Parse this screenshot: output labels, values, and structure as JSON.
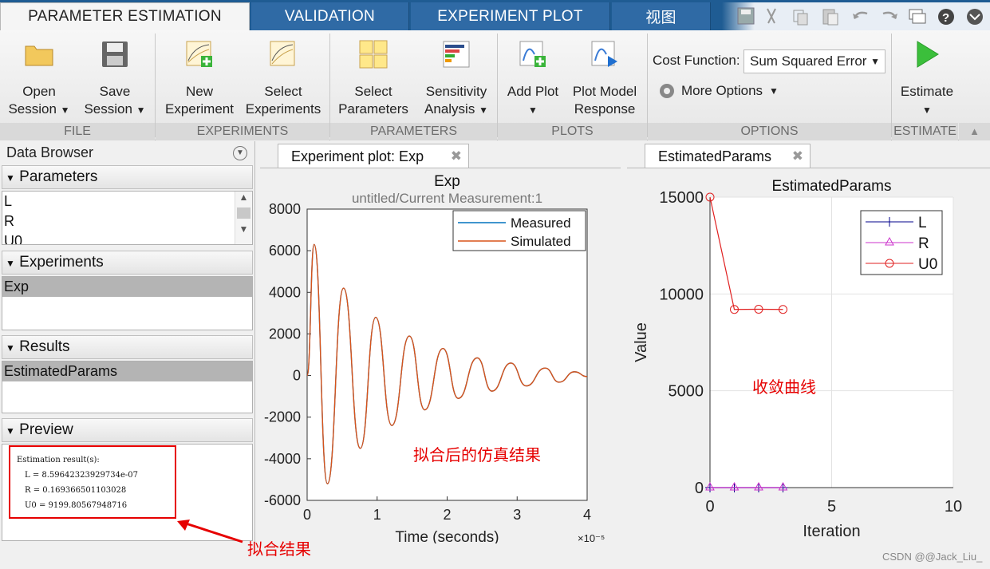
{
  "tabs": [
    {
      "label": "PARAMETER ESTIMATION"
    },
    {
      "label": "VALIDATION"
    },
    {
      "label": "EXPERIMENT PLOT"
    },
    {
      "label": "视图"
    }
  ],
  "ribbon": {
    "open_session": {
      "line1": "Open",
      "line2": "Session"
    },
    "save_session": {
      "line1": "Save",
      "line2": "Session"
    },
    "new_experiment": {
      "line1": "New",
      "line2": "Experiment"
    },
    "select_experiments": {
      "line1": "Select",
      "line2": "Experiments"
    },
    "select_parameters": {
      "line1": "Select",
      "line2": "Parameters"
    },
    "sensitivity_analysis": {
      "line1": "Sensitivity",
      "line2": "Analysis"
    },
    "add_plot": {
      "line1": "Add Plot"
    },
    "plot_model_response": {
      "line1": "Plot Model",
      "line2": "Response"
    },
    "cost_function_label": "Cost Function:",
    "cost_function_value": "Sum Squared Error",
    "more_options": "More Options",
    "estimate": "Estimate",
    "groups": {
      "file": "FILE",
      "experiments": "EXPERIMENTS",
      "parameters": "PARAMETERS",
      "plots": "PLOTS",
      "options": "OPTIONS",
      "estimate": "ESTIMATE"
    }
  },
  "data_browser": {
    "title": "Data Browser",
    "parameters_head": "Parameters",
    "parameters": [
      "L",
      "R",
      "U0"
    ],
    "experiments_head": "Experiments",
    "experiments": [
      "Exp"
    ],
    "results_head": "Results",
    "results": [
      "EstimatedParams"
    ],
    "preview_head": "Preview",
    "preview_lines": [
      "Estimation result(s):",
      "L = 8.59642323929734e-07",
      "R = 0.169366501103028",
      "U0 = 9199.80567948716"
    ]
  },
  "doc_tabs": {
    "experiment_plot": "Experiment plot: Exp",
    "estimated_params": "EstimatedParams"
  },
  "annotations": {
    "fit_sim": "拟合后的仿真结果",
    "convergence": "收敛曲线",
    "fit_result": "拟合结果"
  },
  "watermark": "CSDN @@Jack_Liu_",
  "colors": {
    "tabbar": "#1f5c93",
    "measured": "#0072bd",
    "simulated": "#d95319",
    "L": "#00008b",
    "R": "#cc33cc",
    "U0": "#e02020",
    "annotation": "#e60000"
  },
  "chart_data": [
    {
      "type": "line",
      "title": "Exp",
      "subtitle": "untitled/Current Measurement:1",
      "xlabel": "Time (seconds)",
      "x_exponent_label": "×10⁻⁵",
      "xlim": [
        0,
        4
      ],
      "ylim": [
        -6000,
        8000
      ],
      "xticks": [
        "0",
        "1",
        "2",
        "3",
        "4"
      ],
      "yticks": [
        "-6000",
        "-4000",
        "-2000",
        "0",
        "2000",
        "4000",
        "6000",
        "8000"
      ],
      "legend": [
        "Measured",
        "Simulated"
      ],
      "legend_position": "top-right",
      "series": [
        {
          "name": "Measured",
          "x": [
            0,
            0.1,
            0.29,
            0.52,
            0.76,
            0.98,
            1.21,
            1.46,
            1.68,
            1.94,
            2.16,
            2.43,
            2.64,
            2.91,
            3.13,
            3.4,
            3.6,
            3.82,
            4.0
          ],
          "values": [
            0,
            6300,
            -5200,
            4200,
            -3500,
            2800,
            -2400,
            1900,
            -1650,
            1300,
            -1100,
            850,
            -750,
            600,
            -500,
            360,
            -320,
            180,
            -50
          ]
        },
        {
          "name": "Simulated",
          "x": [
            0,
            0.1,
            0.29,
            0.52,
            0.76,
            0.98,
            1.21,
            1.46,
            1.68,
            1.94,
            2.16,
            2.43,
            2.64,
            2.91,
            3.13,
            3.4,
            3.6,
            3.82,
            4.0
          ],
          "values": [
            0,
            6300,
            -5200,
            4200,
            -3500,
            2800,
            -2400,
            1900,
            -1650,
            1300,
            -1100,
            850,
            -750,
            600,
            -500,
            360,
            -320,
            180,
            -50
          ]
        }
      ]
    },
    {
      "type": "line",
      "title": "EstimatedParams",
      "xlabel": "Iteration",
      "ylabel": "Value",
      "xlim": [
        0,
        10
      ],
      "ylim": [
        0,
        15000
      ],
      "xticks": [
        "0",
        "5",
        "10"
      ],
      "yticks": [
        "0",
        "5000",
        "10000",
        "15000"
      ],
      "legend": [
        "L",
        "R",
        "U0"
      ],
      "legend_position": "top-right",
      "grid": true,
      "x": [
        0,
        1,
        2,
        3
      ],
      "series": [
        {
          "name": "L",
          "values": [
            0,
            0,
            0,
            0
          ]
        },
        {
          "name": "R",
          "values": [
            0,
            0,
            0,
            0
          ]
        },
        {
          "name": "U0",
          "values": [
            15000,
            9200,
            9210,
            9200
          ]
        }
      ]
    }
  ]
}
